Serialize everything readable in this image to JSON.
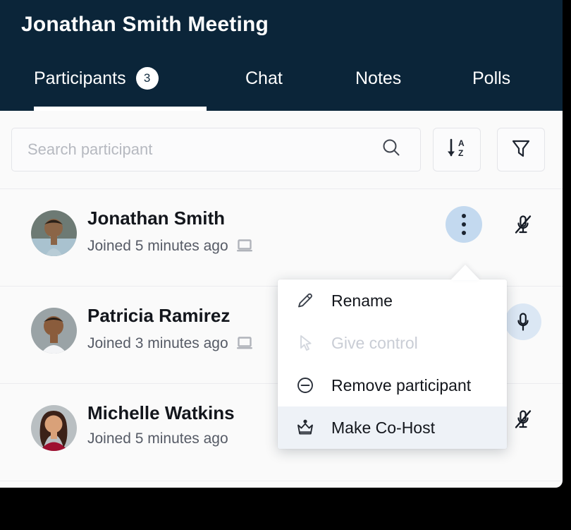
{
  "window": {
    "frame_bg": "#000000",
    "app_bg": "#fafafa"
  },
  "header": {
    "title": "Jonathan Smith Meeting",
    "bg_color": "#0b2539",
    "text_color": "#ffffff",
    "tabs": [
      {
        "label": "Participants",
        "badge": "3",
        "active": true,
        "name": "tab-participants"
      },
      {
        "label": "Chat",
        "badge": "",
        "active": false,
        "name": "tab-chat"
      },
      {
        "label": "Notes",
        "badge": "",
        "active": false,
        "name": "tab-notes"
      },
      {
        "label": "Polls",
        "badge": "",
        "active": false,
        "name": "tab-polls"
      }
    ]
  },
  "toolbar": {
    "search": {
      "placeholder": "Search participant",
      "value": "",
      "icon": "search-icon"
    },
    "sort_button": {
      "icon": "sort-alpha-descending-icon",
      "tooltip": ""
    },
    "filter_button": {
      "icon": "funnel-filter-icon",
      "tooltip": ""
    }
  },
  "participants": [
    {
      "name": "Jonathan Smith",
      "joined": "Joined 5 minutes ago",
      "device_icon": "laptop-icon",
      "has_device": true,
      "mic_state": "muted",
      "mic_icon": "microphone-muted-icon",
      "mic_halo": false,
      "menu_open": true,
      "avatar": "avatar-jonathan-smith"
    },
    {
      "name": "Patricia Ramirez",
      "joined": "Joined 3 minutes ago",
      "device_icon": "laptop-icon",
      "has_device": true,
      "mic_state": "unmuted",
      "mic_icon": "microphone-icon",
      "mic_halo": true,
      "menu_open": false,
      "avatar": "avatar-patricia-ramirez"
    },
    {
      "name": "Michelle Watkins",
      "joined": "Joined 5 minutes ago",
      "device_icon": "",
      "has_device": false,
      "mic_state": "muted",
      "mic_icon": "microphone-muted-icon",
      "mic_halo": false,
      "menu_open": false,
      "avatar": "avatar-michelle-watkins"
    }
  ],
  "context_menu": {
    "owner": "Jonathan Smith",
    "highlight_color": "#eef2f7",
    "items": [
      {
        "label": "Rename",
        "icon": "pencil-icon",
        "disabled": false,
        "highlighted": false
      },
      {
        "label": "Give control",
        "icon": "cursor-arrow-icon",
        "disabled": true,
        "highlighted": false
      },
      {
        "label": "Remove participant",
        "icon": "minus-circle-icon",
        "disabled": false,
        "highlighted": false
      },
      {
        "label": "Make Co-Host",
        "icon": "crown-icon",
        "disabled": false,
        "highlighted": true
      }
    ]
  },
  "colors": {
    "accent_navy": "#0b2539",
    "active_button_blue": "#c3d9ef",
    "mic_halo_blue": "#dbe7f4",
    "muted_text": "#565b66",
    "disabled_text": "#c9cdd5"
  }
}
